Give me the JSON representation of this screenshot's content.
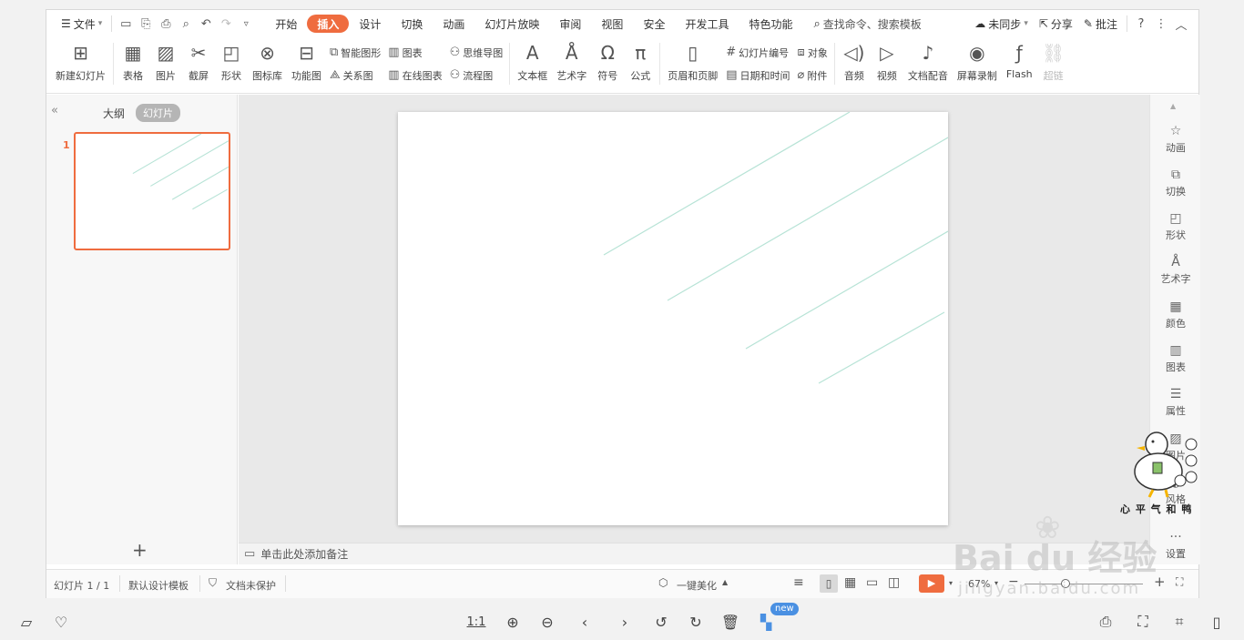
{
  "menubar": {
    "file_label": "文件",
    "tabs": [
      "开始",
      "插入",
      "设计",
      "切换",
      "动画",
      "幻灯片放映",
      "审阅",
      "视图",
      "安全",
      "开发工具",
      "特色功能"
    ],
    "active_tab": "插入",
    "search_placeholder": "查找命令、搜索模板",
    "sync_label": "未同步",
    "share_label": "分享",
    "comment_label": "批注"
  },
  "ribbon": {
    "new_slide": "新建幻灯片",
    "table": "表格",
    "picture": "图片",
    "screenshot": "截屏",
    "shape": "形状",
    "icon_lib": "图标库",
    "func_chart": "功能图",
    "smart_art": "智能图形",
    "chart": "图表",
    "relation": "关系图",
    "online_chart": "在线图表",
    "mind_map": "思维导图",
    "flow_chart": "流程图",
    "text_box": "文本框",
    "art_text": "艺术字",
    "symbol": "符号",
    "formula": "公式",
    "header_footer": "页眉和页脚",
    "slide_number": "幻灯片编号",
    "object": "对象",
    "datetime": "日期和时间",
    "attachment": "附件",
    "audio": "音频",
    "video": "视频",
    "doc_audio": "文档配音",
    "screen_record": "屏幕录制",
    "flash": "Flash",
    "hyperlink": "超链"
  },
  "leftpanel": {
    "outline_tab": "大纲",
    "slides_tab": "幻灯片",
    "slide_number": "1",
    "add_label": "+"
  },
  "notes": {
    "placeholder": "单击此处添加备注"
  },
  "rightpanel": {
    "items": [
      "动画",
      "切换",
      "形状",
      "艺术字",
      "颜色",
      "图表",
      "属性",
      "图片",
      "风格",
      "设置"
    ]
  },
  "statusbar": {
    "slide_counter": "幻灯片 1 / 1",
    "template": "默认设计模板",
    "protection": "文档未保护",
    "beautify": "一键美化",
    "zoom": "67%"
  },
  "bottombar": {
    "ratio_label": "1:1",
    "new_badge": "new"
  },
  "watermark": {
    "baidu_text": "Bai du 经验",
    "baidu_url": "jingyan.baidu.com",
    "duck_caption": "心 平 气 和 鸭"
  },
  "colors": {
    "accent": "#ef6c3f",
    "slide_line": "#b7e3d6"
  }
}
